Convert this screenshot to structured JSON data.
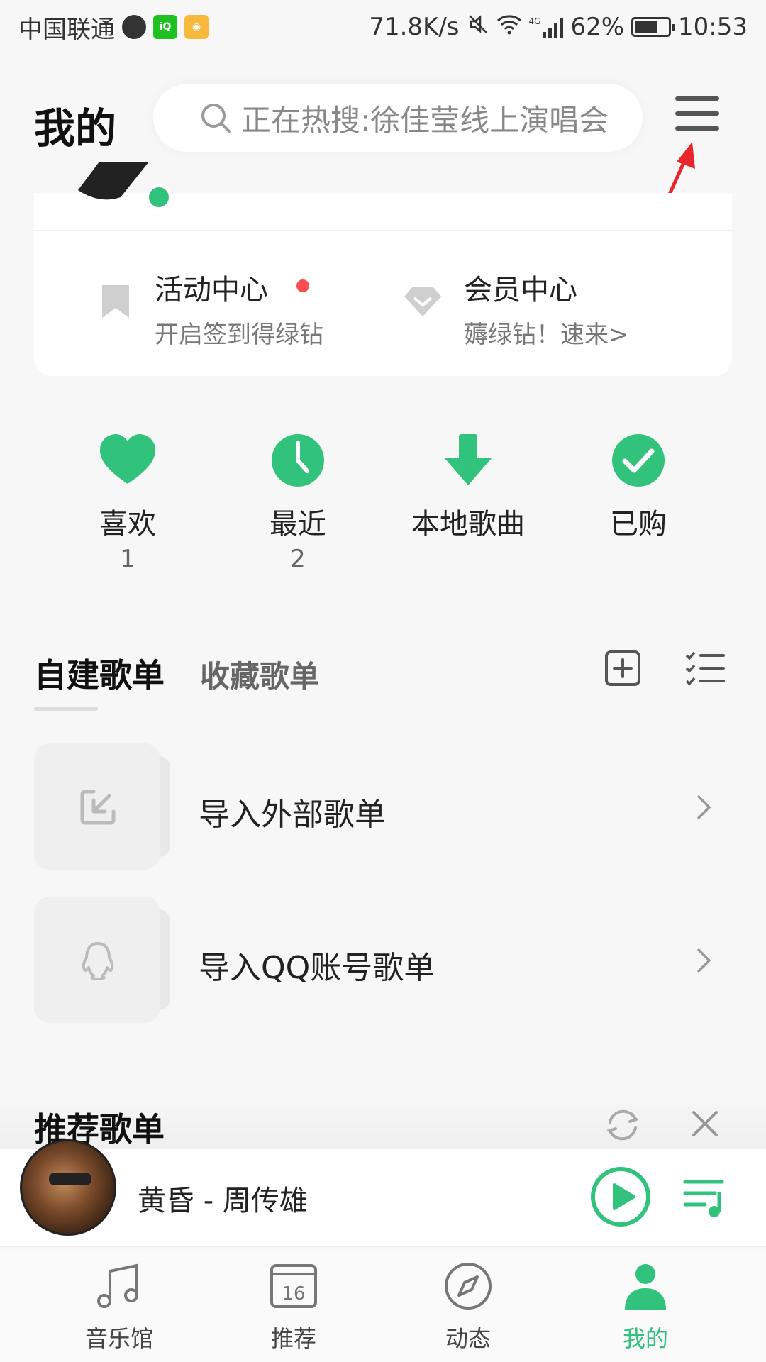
{
  "status_bar": {
    "carrier": "中国联通",
    "net_speed": "71.8K/s",
    "network": "4G",
    "battery": "62%",
    "time": "10:53"
  },
  "header": {
    "title": "我的",
    "search_placeholder": "正在热搜:徐佳莹线上演唱会"
  },
  "card": {
    "activity": {
      "title": "活动中心",
      "subtitle": "开启签到得绿钻"
    },
    "vip": {
      "title": "会员中心",
      "subtitle": "薅绿钻！速来>"
    }
  },
  "quick_actions": [
    {
      "label": "喜欢",
      "count": "1"
    },
    {
      "label": "最近",
      "count": "2"
    },
    {
      "label": "本地歌曲",
      "count": ""
    },
    {
      "label": "已购",
      "count": ""
    }
  ],
  "tabs": {
    "active": "自建歌单",
    "inactive": "收藏歌单"
  },
  "playlists": [
    {
      "label": "导入外部歌单"
    },
    {
      "label": "导入QQ账号歌单"
    }
  ],
  "recommend": {
    "title": "推荐歌单"
  },
  "player": {
    "song": "黄昏 - 周传雄"
  },
  "bottom_nav": [
    {
      "label": "音乐馆"
    },
    {
      "label": "推荐",
      "calendar_day": "16"
    },
    {
      "label": "动态"
    },
    {
      "label": "我的"
    }
  ],
  "colors": {
    "accent": "#31c27c",
    "red_dot": "#ff4d4f",
    "annotation_arrow": "#e8262b"
  }
}
